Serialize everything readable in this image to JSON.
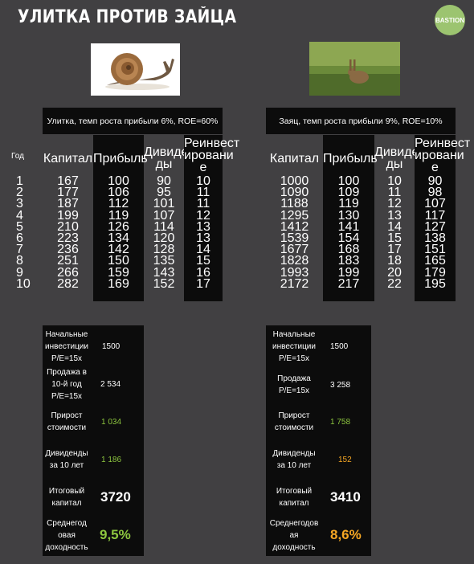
{
  "title": "УЛИТКА ПРОТИВ ЗАЙЦА",
  "logo": "BASTION",
  "year_header": "Год",
  "years": [
    "1",
    "2",
    "3",
    "4",
    "5",
    "6",
    "7",
    "8",
    "9",
    "10"
  ],
  "snail": {
    "header": "Улитка, темп роста прибыли 6%, ROE=60%",
    "col_capital": "Капитал",
    "col_profit": "Прибыль",
    "col_div": "Дивиден\nды",
    "col_reinv": "Реинвест\nировани\nе",
    "capital": [
      "167",
      "177",
      "187",
      "199",
      "210",
      "223",
      "236",
      "251",
      "266",
      "282"
    ],
    "profit": [
      "100",
      "106",
      "112",
      "119",
      "126",
      "134",
      "142",
      "150",
      "159",
      "169"
    ],
    "dividends": [
      "90",
      "95",
      "101",
      "107",
      "114",
      "120",
      "128",
      "135",
      "143",
      "152"
    ],
    "reinvest": [
      "10",
      "11",
      "11",
      "12",
      "13",
      "13",
      "14",
      "15",
      "16",
      "17"
    ],
    "summary": {
      "initial_label": "Начальные\nинвестиции\nP/E=15x",
      "initial_value": "1500",
      "sale_label": "Продажа в\n10-й год\nP/E=15x",
      "sale_value": "2 534",
      "growth_label": "Прирост\nстоимости",
      "growth_value": "1 034",
      "div_label": "Дивиденды\nза 10 лет",
      "div_value": "1 186",
      "total_label": "Итоговый\nкапитал",
      "total_value": "3720",
      "yield_label": "Среднегод\nовая\nдоходность",
      "yield_value": "9,5%"
    }
  },
  "hare": {
    "header": "Заяц, темп роста прибыли 9%, ROE=10%",
    "col_capital": "Капитал",
    "col_profit": "Прибыль",
    "col_div": "Дивиден\nды",
    "col_reinv": "Реинвест\nировани\nе",
    "capital": [
      "1000",
      "1090",
      "1188",
      "1295",
      "1412",
      "1539",
      "1677",
      "1828",
      "1993",
      "2172"
    ],
    "profit": [
      "100",
      "109",
      "119",
      "130",
      "141",
      "154",
      "168",
      "183",
      "199",
      "217"
    ],
    "dividends": [
      "10",
      "11",
      "12",
      "13",
      "14",
      "15",
      "17",
      "18",
      "20",
      "22"
    ],
    "reinvest": [
      "90",
      "98",
      "107",
      "117",
      "127",
      "138",
      "151",
      "165",
      "179",
      "195"
    ],
    "summary": {
      "initial_label": "Начальные\nинвестиции\nP/E=15x",
      "initial_value": "1500",
      "sale_label": "Продажа\nP/E=15x",
      "sale_value": "3 258",
      "growth_label": "Прирост\nстоимости",
      "growth_value": "1 758",
      "div_label": "Дивиденды\nза 10 лет",
      "div_value": "152",
      "total_label": "Итоговый\nкапитал",
      "total_value": "3410",
      "yield_label": "Среднегодов\nая\nдоходность",
      "yield_value": "8,6%"
    }
  }
}
